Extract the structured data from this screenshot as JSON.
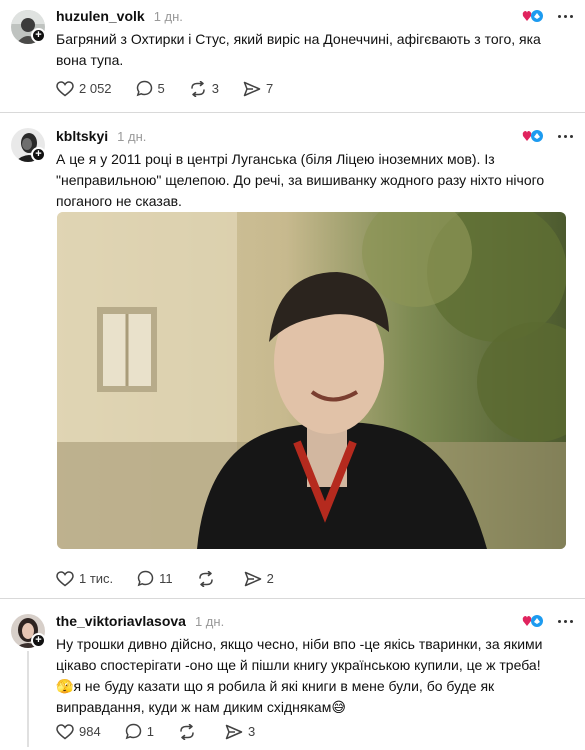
{
  "posts": [
    {
      "username": "huzulen_volk",
      "time": "1 дн.",
      "text": "Багряний з Охтирки і Стус, який виріс на Донеччині, афігєвають з того, яка вона тупа.",
      "likes": "2 052",
      "comments": "5",
      "reposts": "3",
      "shares": "7"
    },
    {
      "username": "kbltskyi",
      "time": "1 дн.",
      "text": "А це я у 2011 році в центрі Луганська (біля Ліцею іноземних мов). Із \"неправильною\" щелепою. До речі, за вишиванку жодного разу ніхто нічого поганого не сказав.",
      "likes": "1 тис.",
      "comments": "11",
      "reposts": "",
      "shares": "2"
    },
    {
      "username": "the_viktoriavlasova",
      "time": "1 дн.",
      "text_main": "Ну трошки дивно дійсно, якщо чесно, ніби впо -це якісь тваринки, за якими цікаво спостерігати -оно ще й пішли книгу українською купили, це ж треба!",
      "text_second": "я не буду казати що я робила й які книги в мене були, бо буде як виправдання, куди ж нам диким східнякам",
      "likes": "984",
      "comments": "1",
      "reposts": "",
      "shares": "3"
    }
  ],
  "icons": {
    "like": "heart-icon",
    "comment": "comment-icon",
    "repost": "repost-icon",
    "share": "share-icon",
    "follow": "plus-icon",
    "more": "more-dots-icon"
  },
  "colors": {
    "text": "#101010",
    "muted": "#999999",
    "action": "#424242",
    "divider": "#d9d9d9",
    "heart_badge": "#e0245e",
    "blue_badge": "#1d9bf0"
  }
}
